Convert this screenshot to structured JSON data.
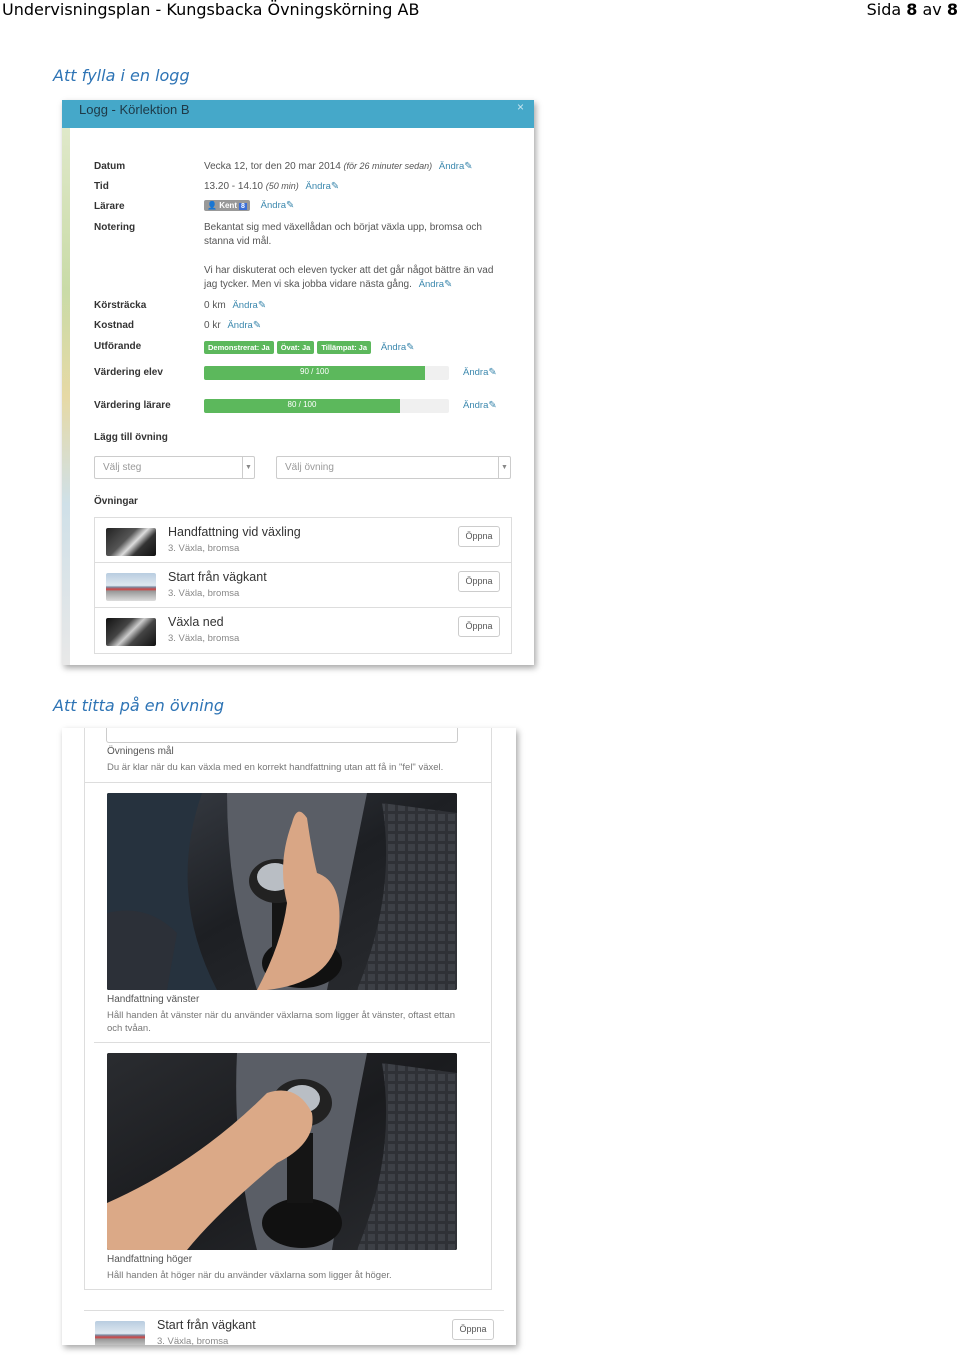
{
  "document": {
    "title": "Undervisningsplan - Kungsbacka Övningskörning AB",
    "page_prefix": "Sida",
    "page_current": "8",
    "page_sep": "av",
    "page_total": "8"
  },
  "headings": {
    "log": "Att fylla i en logg",
    "exercise": "Att titta på en övning"
  },
  "log_modal": {
    "title": "Logg - Körlektion B",
    "close": "×",
    "edit_label": "Ändra",
    "rows": {
      "datum": {
        "label": "Datum",
        "value": "Vecka 12, tor den 20 mar 2014",
        "hint": "(för 26 minuter sedan)"
      },
      "tid": {
        "label": "Tid",
        "value": "13.20 - 14.10",
        "hint": "(50 min)"
      },
      "larare": {
        "label": "Lärare",
        "badge": "Kent",
        "badge_extra": "8"
      },
      "notering": {
        "label": "Notering",
        "para1": "Bekantat sig med växellådan och börjat växla upp, bromsa och stanna vid mål.",
        "para2": "Vi har diskuterat och eleven tycker att det går något bättre än vad jag tycker. Men vi ska jobba vidare nästa gång."
      },
      "korstracka": {
        "label": "Körsträcka",
        "value": "0 km"
      },
      "kostnad": {
        "label": "Kostnad",
        "value": "0 kr"
      },
      "utforande": {
        "label": "Utförande",
        "tags": [
          "Demonstrerat: Ja",
          "Övat: Ja",
          "Tillämpat: Ja"
        ]
      },
      "vardering_elev": {
        "label": "Värdering elev",
        "text": "90 / 100",
        "fraction": 0.9
      },
      "vardering_larare": {
        "label": "Värdering lärare",
        "text": "80 / 100",
        "fraction": 0.8
      }
    },
    "add_exercise": {
      "label": "Lägg till övning",
      "step_placeholder": "Välj steg",
      "exercise_placeholder": "Välj övning"
    },
    "exercises_label": "Övningar",
    "exercises": [
      {
        "title": "Handfattning vid växling",
        "sub": "3. Växla, bromsa",
        "button": "Öppna"
      },
      {
        "title": "Start från vägkant",
        "sub": "3. Växla, bromsa",
        "button": "Öppna"
      },
      {
        "title": "Växla ned",
        "sub": "3. Växla, bromsa",
        "button": "Öppna"
      }
    ]
  },
  "exercise_view": {
    "goal_label": "Övningens mål",
    "goal_text": "Du är klar när du kan växla med en korrekt handfattning utan att få in \"fel\" växel.",
    "photos": [
      {
        "title": "Handfattning vänster",
        "text": "Håll handen åt vänster när du använder växlarna som ligger åt vänster, oftast ettan och tvåan."
      },
      {
        "title": "Handfattning höger",
        "text": "Håll handen åt höger när du använder växlarna som ligger åt höger."
      }
    ],
    "next_item": {
      "title": "Start från vägkant",
      "sub": "3. Växla, bromsa",
      "button": "Öppna"
    }
  }
}
